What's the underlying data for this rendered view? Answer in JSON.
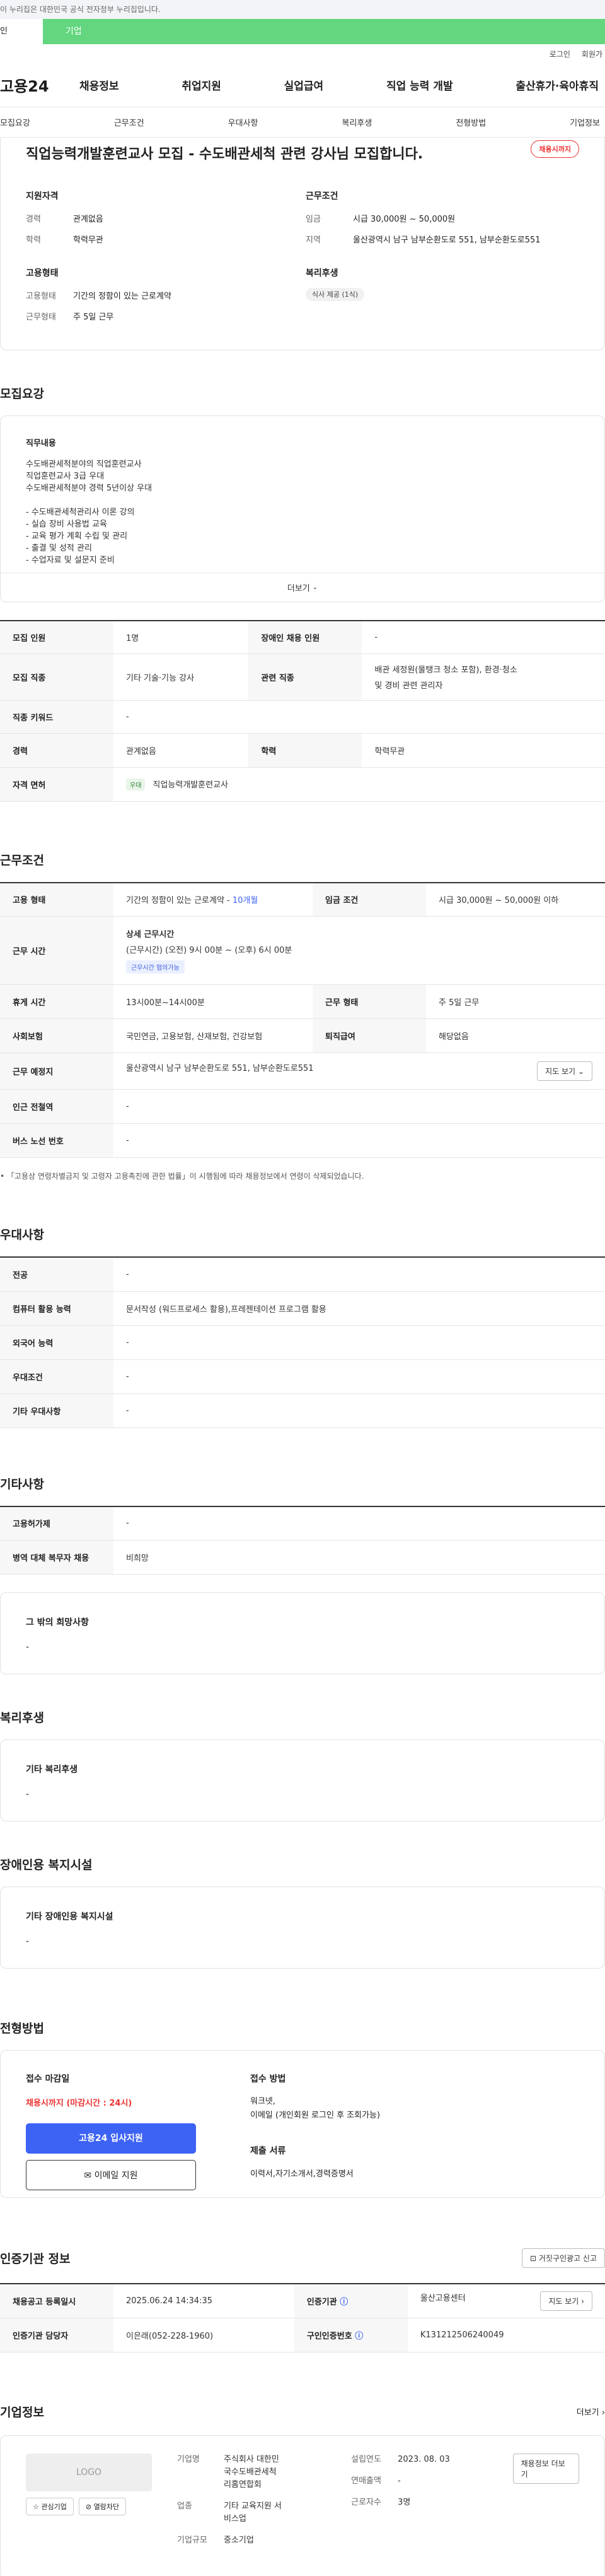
{
  "gov_banner": "이 누리집은 대한민국 공식 전자정부 누리집입니다.",
  "gov_row": {
    "left": "인",
    "right": "기업"
  },
  "util": {
    "login": "로그인",
    "join": "회원가"
  },
  "logo": "고용24",
  "gnb": [
    "채용정보",
    "취업지원",
    "실업급여",
    "직업 능력 개발",
    "출산휴가·육아휴직"
  ],
  "subnav": [
    "모집요강",
    "근무조건",
    "우대사항",
    "복리후생",
    "전형방법",
    "기업정보"
  ],
  "summary": {
    "title": "직업능력개발훈련교사 모집 - 수도배관세척 관련 강사님 모집합니다.",
    "status": "채용시까지",
    "qualification_heading": "지원자격",
    "career_label": "경력",
    "career_value": "관계없음",
    "education_label": "학력",
    "education_value": "학력무관",
    "employment_heading": "고용형태",
    "emp_type_label": "고용형태",
    "emp_type_value": "기간의 정함이 있는 근로계약",
    "work_form_label": "근무형태",
    "work_form_value": "주 5일 근무",
    "conditions_heading": "근무조건",
    "wage_label": "임금",
    "wage_value": "시급 30,000원 ~ 50,000원",
    "region_label": "지역",
    "region_value": "울산광역시 남구 남부순환도로 551, 남부순환도로551",
    "welfare_heading": "복리후생",
    "welfare_chip": "식사 제공 (1식)"
  },
  "recruit": {
    "section_title": "모집요강",
    "job_heading": "직무내용",
    "job_lines": [
      "수도배관세척분야의 직업훈련교사",
      "직업훈련교사 3급 우대",
      "수도배관세척분야 경력 5년이상 우대",
      "",
      "- 수도배관세척관리사 이론 강의",
      "- 실습 장비 사용법 교육",
      "- 교육 평가 계획 수립 및 관리",
      "- 출결 및 성적 관리",
      "- 수업자료 및 설문지 준비"
    ],
    "more_label": "더보기",
    "table": {
      "r1": {
        "k1": "모집 인원",
        "v1": "1명",
        "k2": "장애인 채용 인원",
        "v2": "-"
      },
      "r2": {
        "k1": "모집 직종",
        "v1": "기타 기술·기능 강사",
        "k2": "관련 직종",
        "v2a": "배관 세정원(물탱크 청소 포함), 환경·청소",
        "v2b": "및 경비 관련 관리자"
      },
      "r3": {
        "k1": "직종 키워드",
        "v1": "-"
      },
      "r4": {
        "k1": "경력",
        "v1": "관계없음",
        "k2": "학력",
        "v2": "학력무관"
      },
      "r5": {
        "k1": "자격 면허",
        "chip": "우대",
        "v1": "직업능력개발훈련교사"
      }
    }
  },
  "conditions": {
    "section_title": "근무조건",
    "r1": {
      "k1": "고용 형태",
      "v1": "기간의 정함이 있는 근로계약 -",
      "v1_highlight": "10개월",
      "k2": "임금 조건",
      "v2": "시급 30,000원 ~ 50,000원 이하"
    },
    "r2": {
      "k1": "근무 시간",
      "head": "상세 근무시간",
      "line": "(근무시간) (오전) 9시 00분 ~ (오후) 6시 00분",
      "chip": "근무시간 협의가능"
    },
    "r3": {
      "k1": "휴게 시간",
      "v1": "13시00분~14시00분",
      "k2": "근무 형태",
      "v2": "주 5일 근무"
    },
    "r4": {
      "k1": "사회보험",
      "v1": "국민연금, 고용보험, 산재보험, 건강보험",
      "k2": "퇴직급여",
      "v2": "해당없음"
    },
    "r5": {
      "k1": "근무 예정지",
      "v1": "울산광역시 남구 남부순환도로 551, 남부순환도로551",
      "btn": "지도 보기"
    },
    "r6": {
      "k1": "인근 전철역",
      "v1": "-"
    },
    "r7": {
      "k1": "버스 노선 번호",
      "v1": "-"
    },
    "note": "「고용상 연령차별금지 및 고령자 고용촉진에 관한 법률」이 시행됨에 따라 채용정보에서 연령이 삭제되었습니다."
  },
  "preference": {
    "section_title": "우대사항",
    "rows": [
      {
        "k": "전공",
        "v": "-"
      },
      {
        "k": "컴퓨터 활용 능력",
        "v": "문서작성 (워드프로세스 활용),프레젠테이션 프로그램 활용"
      },
      {
        "k": "외국어 능력",
        "v": "-"
      },
      {
        "k": "우대조건",
        "v": "-"
      },
      {
        "k": "기타 우대사항",
        "v": "-"
      }
    ]
  },
  "etc": {
    "section_title": "기타사항",
    "rows": [
      {
        "k": "고용허가제",
        "v": "-"
      },
      {
        "k": "병역 대체 복무자 채용",
        "v": "비희망"
      }
    ],
    "other_heading": "그 밖의 희망사항",
    "other_value": "-"
  },
  "welfare": {
    "section_title": "복리후생",
    "heading": "기타 복리후생",
    "value": "-"
  },
  "disabled": {
    "section_title": "장애인용 복지시설",
    "heading": "기타 장애인용 복지시설",
    "value": "-"
  },
  "apply": {
    "section_title": "전형방법",
    "deadline_heading": "접수 마감일",
    "deadline_value": "채용시까지 (마감시간 : 24시)",
    "btn_primary": "고용24 입사지원",
    "btn_email": "이메일 지원",
    "method_heading": "접수 방법",
    "method_lines": [
      "워크넷,",
      "이메일 (개인회원 로그인 후 조회가능)"
    ],
    "docs_heading": "제출 서류",
    "docs_value": "이력서,자기소개서,경력증명서"
  },
  "certify": {
    "section_title": "인증기관 정보",
    "report_btn": "거짓구인광고 신고",
    "r1": {
      "k1": "채용공고 등록일시",
      "v1": "2025.06.24 14:34:35",
      "k2": "인증기관",
      "v2": "울산고용센터",
      "btn": "지도 보기"
    },
    "r2": {
      "k1": "인증기관 담당자",
      "v1": "이은래(052-228-1960)",
      "k2": "구인인증번호",
      "v2": "K131212506240049"
    }
  },
  "company": {
    "section_title": "기업정보",
    "more": "더보기",
    "logo": "LOGO",
    "interest": "관심기업",
    "block": "열람차단",
    "name_label": "기업명",
    "name_lines": [
      "주식회사 대한민",
      "국수도배관세척",
      "리홈연합회"
    ],
    "industry_label": "업종",
    "industry_lines": [
      "기타 교육지원 서",
      "비스업"
    ],
    "size_label": "기업규모",
    "size_value": "중소기업",
    "founded_label": "설립연도",
    "founded_value": "2023. 08. 03",
    "sales_label": "연매출액",
    "sales_value": "-",
    "staff_label": "근로자수",
    "staff_value": "3명",
    "jobs_btn": "채용정보 더보기"
  }
}
